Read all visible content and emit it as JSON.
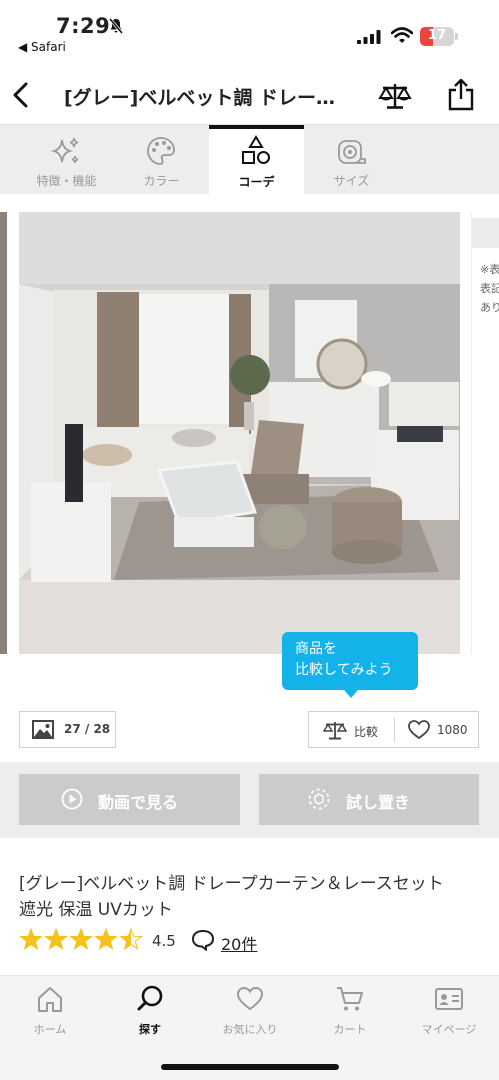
{
  "status_bar": {
    "time": "7:29",
    "back_app": "◀ Safari",
    "battery_level": "17"
  },
  "header": {
    "title": "[グレー]ベルベット調 ドレー…"
  },
  "tabs": [
    {
      "label": "特徴・機能",
      "icon": "sparkle-icon",
      "active": false
    },
    {
      "label": "カラー",
      "icon": "palette-icon",
      "active": false
    },
    {
      "label": "コーデ",
      "icon": "shapes-icon",
      "active": true
    },
    {
      "label": "サイズ",
      "icon": "tape-measure-icon",
      "active": false
    }
  ],
  "carousel": {
    "next_peek_text": "※表\n表記\nあり"
  },
  "tooltip": {
    "text_line1": "商品を",
    "text_line2": "比較してみよう",
    "color": "#13b3ea"
  },
  "image_counter": "27 / 28",
  "actions": {
    "compare_label": "比較",
    "favorite_count": "1080"
  },
  "buttons": {
    "video": "動画で見る",
    "try_placement": "試し置き"
  },
  "product": {
    "name_line1": "[グレー]ベルベット調 ドレープカーテン＆レースセット",
    "name_line2": "遮光 保温 UVカット",
    "rating": "4.5",
    "rating_value": 4.5,
    "reviews": "20件"
  },
  "bottom_nav": [
    {
      "label": "ホーム",
      "icon": "home-icon",
      "active": false
    },
    {
      "label": "探す",
      "icon": "search-icon",
      "active": true
    },
    {
      "label": "お気に入り",
      "icon": "heart-icon",
      "active": false
    },
    {
      "label": "カート",
      "icon": "cart-icon",
      "active": false
    },
    {
      "label": "マイページ",
      "icon": "id-card-icon",
      "active": false
    }
  ],
  "colors": {
    "accent": "#13b3ea",
    "star": "#f3c21b",
    "battery_low": "#e8473f"
  }
}
